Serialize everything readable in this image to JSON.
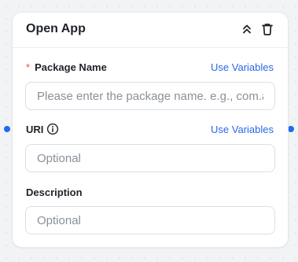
{
  "node": {
    "title": "Open App",
    "collapse_icon": "chevrons-up-icon",
    "delete_icon": "trash-icon",
    "required_mark": "*"
  },
  "fields": {
    "package_name": {
      "label": "Package Name",
      "required": true,
      "action": "Use Variables",
      "placeholder": "Please enter the package name. e.g., com.android.settings",
      "value": ""
    },
    "uri": {
      "label": "URI",
      "info_icon": "info-circle-icon",
      "action": "Use Variables",
      "placeholder": "Optional",
      "value": ""
    },
    "description": {
      "label": "Description",
      "placeholder": "Optional",
      "value": ""
    }
  },
  "colors": {
    "accent": "#2b68e6",
    "port": "#1d6df2",
    "required": "#f54a45",
    "text": "#1f2329",
    "placeholder": "#8a9099"
  }
}
